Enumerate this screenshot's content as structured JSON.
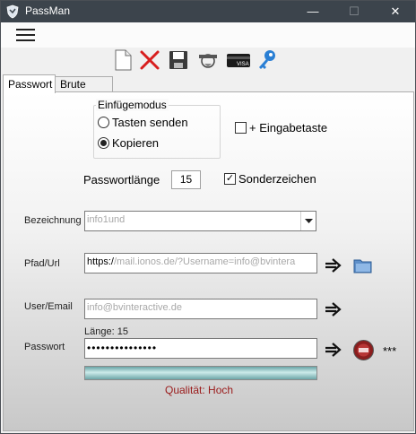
{
  "window": {
    "title": "PassMan",
    "controls": {
      "minimize": "—",
      "maximize": "☐",
      "close": "✕"
    }
  },
  "toolbar": {
    "icons": [
      "new-document-icon",
      "delete-icon",
      "save-icon",
      "key-ring-icon",
      "credit-card-icon",
      "key-icon"
    ],
    "card_text": "VISA"
  },
  "tabs": [
    {
      "label": "Passwort",
      "active": true
    },
    {
      "label": "Brute Force",
      "active": false
    }
  ],
  "mode_group": {
    "title": "Einfügemodus",
    "options": [
      {
        "label": "Tasten senden",
        "selected": false
      },
      {
        "label": "Kopieren",
        "selected": true
      }
    ]
  },
  "enter_key": {
    "label": "+ Eingabetaste",
    "checked": false
  },
  "length": {
    "label": "Passwortlänge",
    "value": "15"
  },
  "special_chars": {
    "label": "Sonderzeichen",
    "checked": true
  },
  "fields": {
    "bezeichnung": {
      "label": "Bezeichnung",
      "value": "info1und"
    },
    "pfad": {
      "label": "Pfad/Url",
      "prefix": "https:/",
      "value": "/mail.ionos.de/?Username=info@bvintera"
    },
    "user": {
      "label": "User/Email",
      "value": "info@bvinteractive.de"
    },
    "passwort": {
      "label": "Passwort",
      "length_label": "Länge: 15",
      "value": "•••••••••••••••",
      "mask_toggle": "***"
    }
  },
  "quality": {
    "label": "Qualität: Hoch",
    "strength": 1.0
  },
  "colors": {
    "titlebar": "#3c444c",
    "quality_text": "#9a1a1a",
    "bar": "#9fd3d3"
  }
}
